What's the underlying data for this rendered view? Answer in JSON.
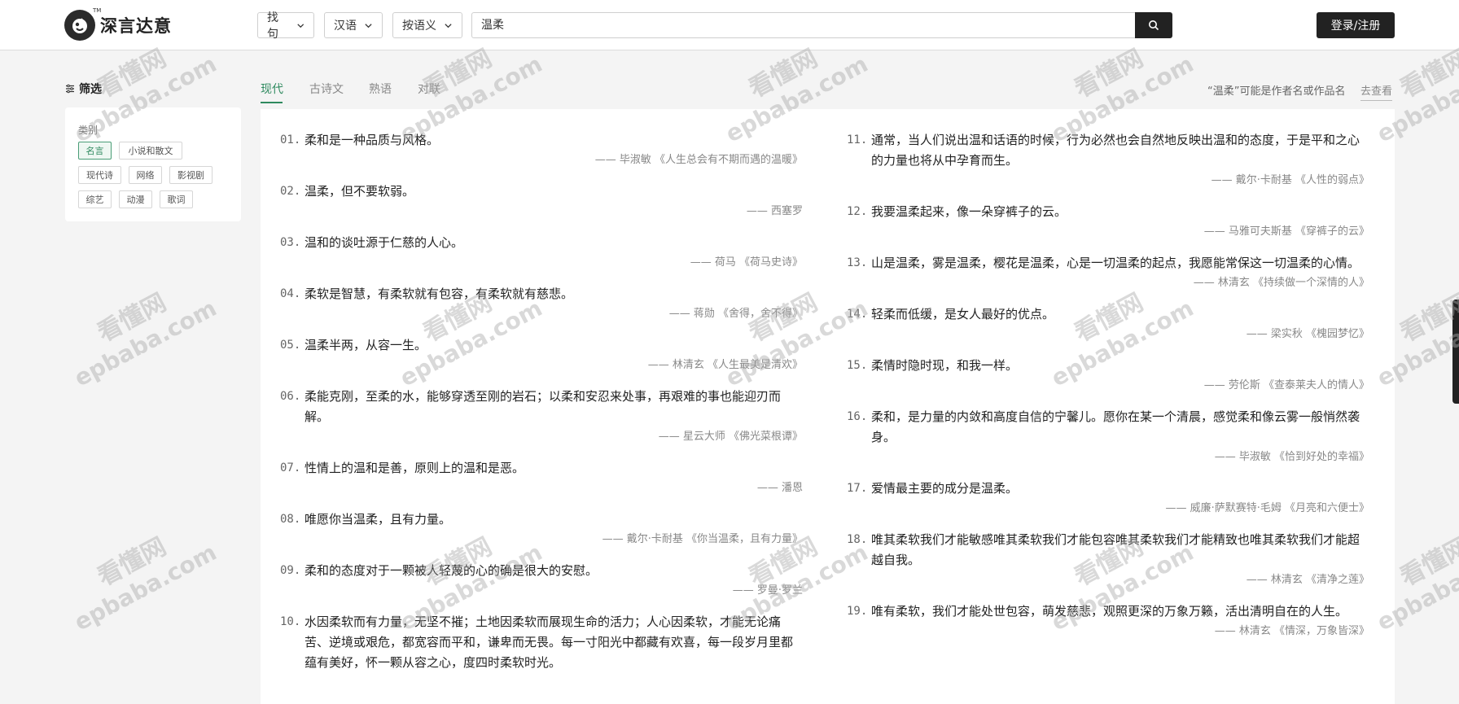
{
  "header": {
    "logo_tm": "TM",
    "logo_text": "深言达意",
    "dropdowns": [
      "找句",
      "汉语",
      "按语义"
    ],
    "search_value": "温柔",
    "login_label": "登录/注册"
  },
  "sidebar": {
    "filter_label": "筛选",
    "category_label": "类别",
    "tags": [
      "名言",
      "小说和散文",
      "现代诗",
      "网络",
      "影视剧",
      "综艺",
      "动漫",
      "歌词"
    ],
    "active_tag": "名言"
  },
  "tabs": [
    "现代",
    "古诗文",
    "熟语",
    "对联"
  ],
  "active_tab": "现代",
  "hint": {
    "text": "“温柔”可能是作者名或作品名",
    "link": "去查看"
  },
  "quotes_left": [
    {
      "num": "01.",
      "text": "柔和是一种品质与风格。",
      "source": "—— 毕淑敏 《人生总会有不期而遇的温暖》"
    },
    {
      "num": "02.",
      "text": "温柔，但不要软弱。",
      "source": "—— 西塞罗"
    },
    {
      "num": "03.",
      "text": "温和的谈吐源于仁慈的人心。",
      "source": "—— 荷马 《荷马史诗》"
    },
    {
      "num": "04.",
      "text": "柔软是智慧，有柔软就有包容，有柔软就有慈悲。",
      "source": "—— 蒋勋 《舍得，舍不得》"
    },
    {
      "num": "05.",
      "text": "温柔半两，从容一生。",
      "source": "—— 林清玄 《人生最美是清欢》"
    },
    {
      "num": "06.",
      "text": "柔能克刚，至柔的水，能够穿透至刚的岩石；以柔和安忍来处事，再艰难的事也能迎刃而解。",
      "source": "—— 星云大师 《佛光菜根谭》"
    },
    {
      "num": "07.",
      "text": "性情上的温和是善，原则上的温和是恶。",
      "source": "—— 潘恩"
    },
    {
      "num": "08.",
      "text": "唯愿你当温柔，且有力量。",
      "source": "—— 戴尔·卡耐基 《你当温柔，且有力量》"
    },
    {
      "num": "09.",
      "text": "柔和的态度对于一颗被人轻蔑的心的确是很大的安慰。",
      "source": "—— 罗曼·罗兰"
    },
    {
      "num": "10.",
      "text": "水因柔软而有力量，无坚不摧；土地因柔软而展现生命的活力；人心因柔软，才能无论痛苦、逆境或艰危，都宽容而平和，谦卑而无畏。每一寸阳光中都藏有欢喜，每一段岁月里都蕴有美好，怀一颗从容之心，度四时柔软时光。",
      "source": ""
    }
  ],
  "quotes_right": [
    {
      "num": "11.",
      "text": "通常，当人们说出温和话语的时候，行为必然也会自然地反映出温和的态度，于是平和之心的力量也将从中孕育而生。",
      "source": "—— 戴尔·卡耐基 《人性的弱点》"
    },
    {
      "num": "12.",
      "text": "我要温柔起来，像一朵穿裤子的云。",
      "source": "—— 马雅可夫斯基 《穿裤子的云》"
    },
    {
      "num": "13.",
      "text": "山是温柔，雾是温柔，樱花是温柔，心是一切温柔的起点，我愿能常保这一切温柔的心情。",
      "source": "—— 林清玄 《持续做一个深情的人》"
    },
    {
      "num": "14.",
      "text": "轻柔而低缓，是女人最好的优点。",
      "source": "—— 梁实秋 《槐园梦忆》"
    },
    {
      "num": "15.",
      "text": "柔情时隐时现，和我一样。",
      "source": "—— 劳伦斯 《查泰莱夫人的情人》"
    },
    {
      "num": "16.",
      "text": "柔和，是力量的内敛和高度自信的宁馨儿。愿你在某一个清晨，感觉柔和像云雾一般悄然袭身。",
      "source": "—— 毕淑敏 《恰到好处的幸福》"
    },
    {
      "num": "17.",
      "text": "爱情最主要的成分是温柔。",
      "source": "—— 威廉·萨默赛特·毛姆 《月亮和六便士》"
    },
    {
      "num": "18.",
      "text": "唯其柔软我们才能敏感唯其柔软我们才能包容唯其柔软我们才能精致也唯其柔软我们才能超越自我。",
      "source": "—— 林清玄 《清净之莲》"
    },
    {
      "num": "19.",
      "text": "唯有柔软，我们才能处世包容，萌发慈悲，观照更深的万象万籁，活出清明自在的人生。",
      "source": "—— 林清玄 《情深，万象皆深》"
    }
  ],
  "watermark": {
    "line1": "看懂网",
    "line2": "epbaba.com"
  }
}
